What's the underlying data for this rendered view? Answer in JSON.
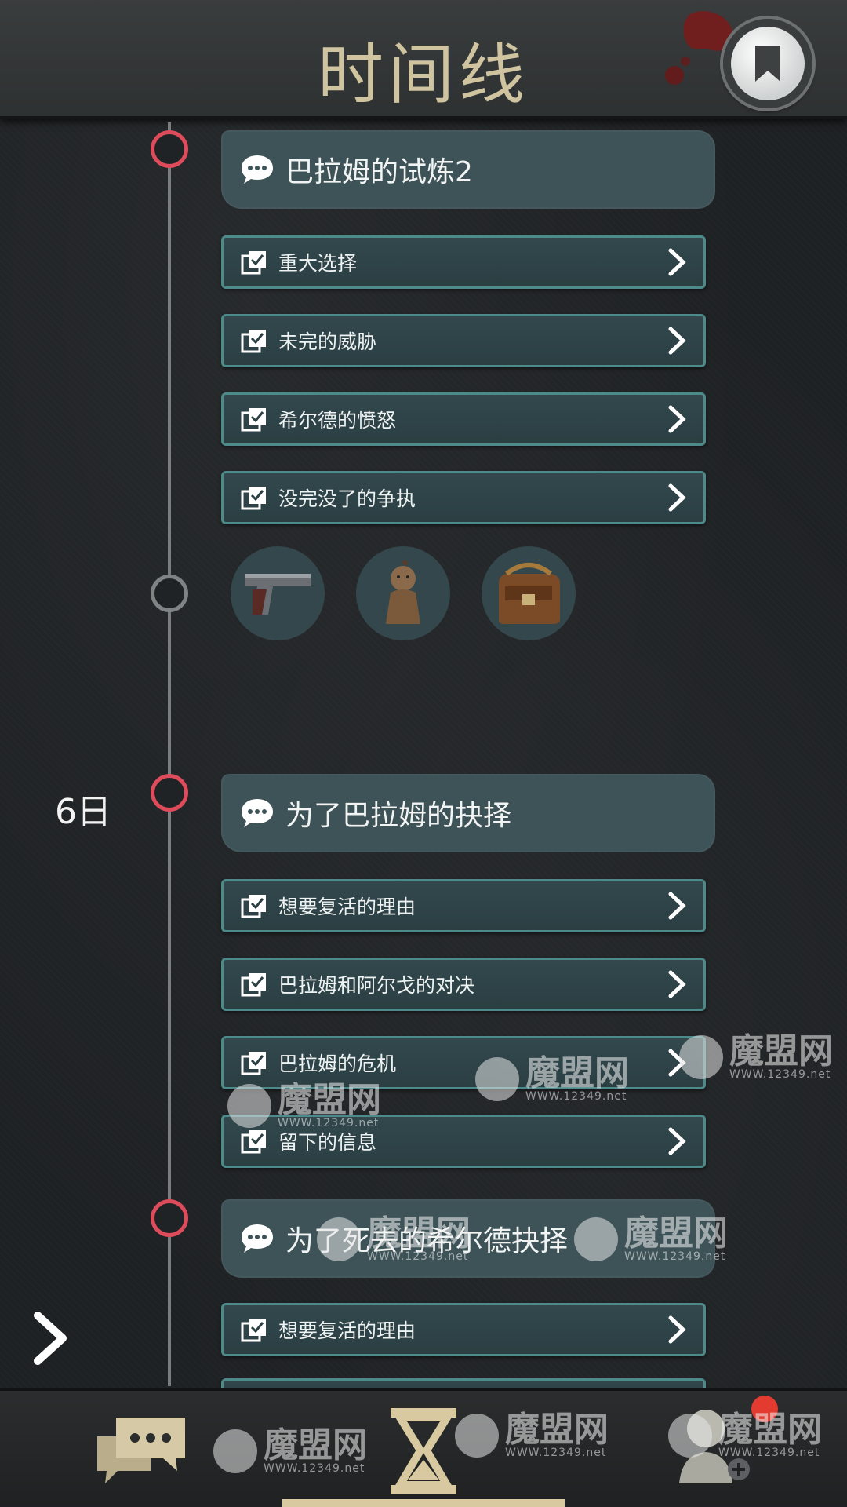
{
  "header": {
    "title": "时间线"
  },
  "day_label": "6日",
  "chapters": [
    {
      "title": "巴拉姆的试炼2",
      "scenes": [
        "重大选择",
        "未完的威胁",
        "希尔德的愤怒",
        "没完没了的争执"
      ]
    },
    {
      "title": "为了巴拉姆的抉择",
      "scenes": [
        "想要复活的理由",
        "巴拉姆和阿尔戈的对决",
        "巴拉姆的危机",
        "留下的信息"
      ]
    },
    {
      "title": "为了死去的希尔德抉择",
      "scenes": [
        "想要复活的理由"
      ]
    }
  ],
  "items": [
    "pistol-icon",
    "doll-icon",
    "bag-icon"
  ],
  "colors": {
    "node_active": "#de4b5b",
    "node_inactive": "#7f8384",
    "scene_border": "#4e8a89",
    "chapter_bg": "#3e5358",
    "accent_gold": "#d9c9a0",
    "badge": "#e33b2f"
  },
  "watermark": {
    "text": "魔盟网",
    "url": "WWW.12349.net"
  }
}
